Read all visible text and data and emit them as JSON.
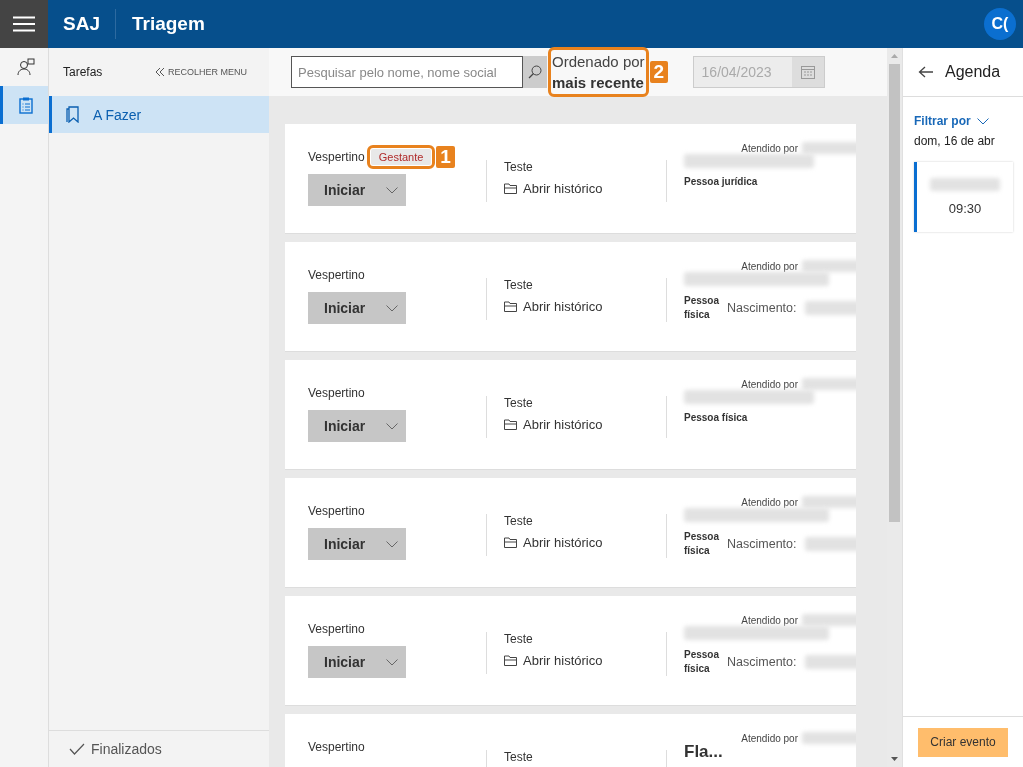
{
  "header": {
    "product": "SAJ",
    "title": "Triagem",
    "avatar": "C("
  },
  "rail": [
    {
      "kind": "people",
      "selected": false
    },
    {
      "kind": "clipboard",
      "selected": true
    }
  ],
  "tasks": {
    "title": "Tarefas",
    "collapse": "RECOLHER MENU",
    "items": [
      {
        "label": "A Fazer",
        "selected": true
      }
    ],
    "footer": "Finalizados"
  },
  "toolbar": {
    "search_placeholder": "Pesquisar pelo nome, nome social",
    "sort": {
      "label": "Ordenado por",
      "value": "mais recente",
      "callout": "2"
    },
    "date": "16/04/2023",
    "date_disabled": true
  },
  "cards": [
    {
      "kind": "legal",
      "shift": "Vespertino",
      "tag": {
        "label": "Gestante",
        "callout": "1"
      },
      "action": "Iniciar",
      "service": "Teste",
      "history": "Abrir histórico",
      "attended": "Atendido por",
      "person_type": "Pessoa jurídica"
    },
    {
      "kind": "natural",
      "shift": "Vespertino",
      "action": "Iniciar",
      "service": "Teste",
      "history": "Abrir histórico",
      "attended": "Atendido por",
      "person_type": "Pessoa física",
      "birth_label": "Nascimento:"
    },
    {
      "kind": "legal",
      "shift": "Vespertino",
      "action": "Iniciar",
      "service": "Teste",
      "history": "Abrir histórico",
      "attended": "Atendido por",
      "person_type": "Pessoa física"
    },
    {
      "kind": "natural",
      "shift": "Vespertino",
      "action": "Iniciar",
      "service": "Teste",
      "history": "Abrir histórico",
      "attended": "Atendido por",
      "person_type": "Pessoa física",
      "birth_label": "Nascimento:"
    },
    {
      "kind": "natural",
      "shift": "Vespertino",
      "action": "Iniciar",
      "service": "Teste",
      "history": "Abrir histórico",
      "attended": "Atendido por",
      "person_type": "Pessoa física",
      "birth_label": "Nascimento:"
    },
    {
      "kind": "named",
      "shift": "Vespertino",
      "service": "Teste",
      "attended": "Atendido por",
      "name": "Fla..."
    }
  ],
  "agenda": {
    "title": "Agenda",
    "filter": "Filtrar por",
    "date": "dom, 16 de abr",
    "events": [
      {
        "time": "09:30"
      }
    ],
    "create": "Criar evento"
  }
}
